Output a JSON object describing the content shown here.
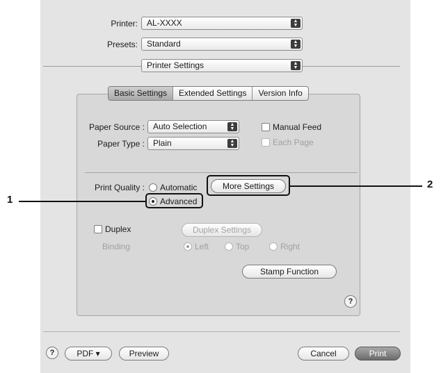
{
  "header": {
    "printer_label": "Printer:",
    "printer_value": "AL-XXXX",
    "presets_label": "Presets:",
    "presets_value": "Standard",
    "pane_value": "Printer Settings"
  },
  "tabs": [
    {
      "label": "Basic Settings",
      "active": true
    },
    {
      "label": "Extended Settings",
      "active": false
    },
    {
      "label": "Version Info",
      "active": false
    }
  ],
  "paper": {
    "source_label": "Paper Source :",
    "source_value": "Auto Selection",
    "type_label": "Paper Type :",
    "type_value": "Plain",
    "manual_feed_label": "Manual Feed",
    "each_page_label": "Each Page"
  },
  "quality": {
    "label": "Print Quality :",
    "automatic_label": "Automatic",
    "advanced_label": "Advanced",
    "selected": "Advanced",
    "more_settings_label": "More Settings"
  },
  "duplex": {
    "label": "Duplex",
    "settings_button": "Duplex Settings",
    "binding_label": "Binding",
    "left": "Left",
    "top": "Top",
    "right": "Right",
    "binding_selected": "Left"
  },
  "stamp_button": "Stamp Function",
  "help_glyph": "?",
  "footer": {
    "pdf_label": "PDF ▾",
    "preview_label": "Preview",
    "cancel_label": "Cancel",
    "print_label": "Print"
  },
  "callouts": {
    "one": "1",
    "two": "2"
  },
  "colors": {
    "dialog_bg": "#e4e4e4",
    "panel_bg": "#d8d8d8",
    "callout": "#111111"
  }
}
